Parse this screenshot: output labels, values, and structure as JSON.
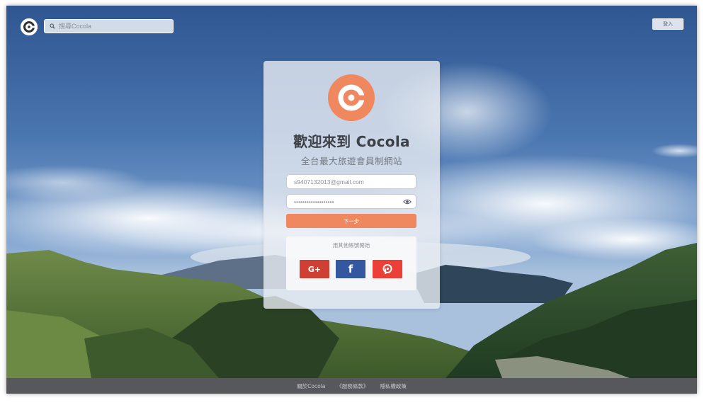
{
  "header": {
    "search_placeholder": "搜尋Cocola",
    "login_label": "登入"
  },
  "card": {
    "title": "歡迎來到 Cocola",
    "subtitle": "全台最大旅遊會員制網站",
    "email_value": "s9407132013@gmail.com",
    "password_value": "•••••••••••••••••••",
    "next_label": "下一步",
    "social_label": "用其他帳號開始",
    "google_label": "G+",
    "facebook_label": "f"
  },
  "footer": {
    "links": [
      "關於Cocola",
      "《服務條款》",
      "隱私權政策"
    ]
  },
  "icons": {
    "logo": "cocola-logo-icon",
    "search": "search-icon",
    "eye": "eye-icon",
    "pixnet": "pixnet-logo-icon"
  },
  "colors": {
    "brand_orange": "#f0885f",
    "google_red": "#d03f33",
    "facebook_blue": "#34589f",
    "pixnet_red": "#ea4037",
    "footer_gray": "#57585b"
  }
}
